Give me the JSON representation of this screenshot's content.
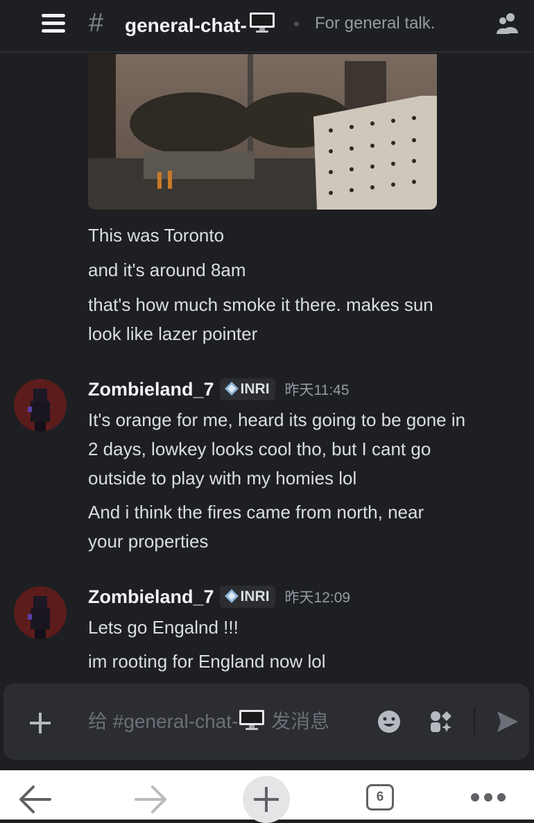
{
  "header": {
    "channel_name": "general-chat-",
    "channel_emoji": "desktop-computer-icon",
    "topic": "For general talk."
  },
  "messages": [
    {
      "author": null,
      "image": "smoky-city-photo",
      "lines": [
        "This was Toronto",
        "and it's around 8am",
        "that's how much smoke it there. makes sun",
        "look like lazer pointer"
      ]
    },
    {
      "author": "Zombieland_7",
      "tag": "INRI",
      "time": "昨天11:45",
      "lines": [
        "It's orange for me, heard its going to be gone in",
        "2 days, lowkey looks cool tho, but I cant go",
        "outside to play with my homies lol",
        "And i think the fires came from north, near",
        "your properties"
      ]
    },
    {
      "author": "Zombieland_7",
      "tag": "INRI",
      "time": "昨天12:09",
      "lines": [
        "Lets go Engalnd !!!",
        "im rooting for England now lol"
      ]
    }
  ],
  "composer": {
    "placeholder_prefix": "给 #general-chat-",
    "placeholder_suffix": " 发消息"
  },
  "browser": {
    "tab_count": "6"
  },
  "colors": {
    "background": "#1e1f22",
    "composer": "#2b2d31",
    "text": "#dbdee1",
    "muted": "#949ba4"
  }
}
